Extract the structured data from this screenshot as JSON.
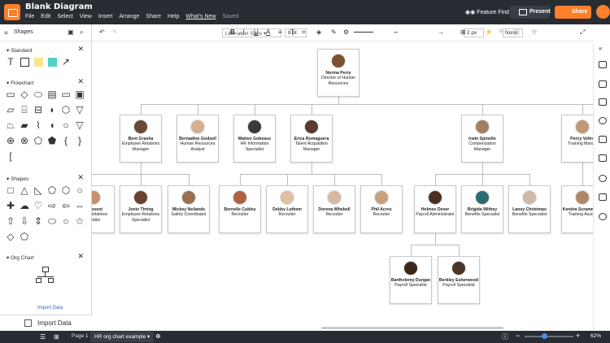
{
  "app": {
    "title": "Blank Diagram",
    "saved": "Saved"
  },
  "menu": [
    "File",
    "Edit",
    "Select",
    "View",
    "Insert",
    "Arrange",
    "Share",
    "Help",
    "What's New"
  ],
  "header": {
    "feature_find": "Feature Find",
    "present": "Present",
    "share": "Share"
  },
  "left_panel": {
    "title": "Shapes",
    "sections": {
      "standard": "Standard",
      "flowchart": "Flowchart",
      "shapes": "Shapes",
      "orgchart": "Org Chart"
    },
    "import_data_small": "Import Data",
    "import_data": "Import Data"
  },
  "toolbar": {
    "font": "Liberation Sans",
    "size": "8 pt",
    "line_width": "2 px",
    "arrow_start": "None"
  },
  "bottom": {
    "page": "Page 1",
    "tab": "HR org chart example",
    "zoom": "62%"
  },
  "org": [
    {
      "id": "root",
      "name": "Norma Perry",
      "title": "Director of Human Resources",
      "photo": "#7a5030"
    },
    {
      "id": "bent",
      "name": "Bent Grasha",
      "title": "Employee Relations Manager",
      "photo": "#6b4a35"
    },
    {
      "id": "bern",
      "name": "Bernadine Godsell",
      "title": "Human Resources Analyst",
      "photo": "#d8b090"
    },
    {
      "id": "matt",
      "name": "Matteo Gobeaux",
      "title": "HR Information Specialist",
      "photo": "#3a3a3a"
    },
    {
      "id": "eric",
      "name": "Erica Romaguera",
      "title": "Talent Acquisition Manager",
      "photo": "#5a3a28"
    },
    {
      "id": "irwin",
      "name": "Irwin Spinello",
      "title": "Compensation Manager",
      "photo": "#a08060"
    },
    {
      "id": "percy",
      "name": "Percy Veltre",
      "title": "Training Manag",
      "photo": "#c09878"
    },
    {
      "id": "rosoni",
      "name": "a Rosoni",
      "title": "oyee Relations ecialist",
      "photo": "#c89070"
    },
    {
      "id": "jonis",
      "name": "Jonis Thring",
      "title": "Employee Relations Specialist",
      "photo": "#6a4030"
    },
    {
      "id": "mickey",
      "name": "Mickey Neilands",
      "title": "Safety Coordinator",
      "photo": "#9a7050"
    },
    {
      "id": "bernelle",
      "name": "Bernelle Cubley",
      "title": "Recruiter",
      "photo": "#b06040"
    },
    {
      "id": "debby",
      "name": "Debby Lethem",
      "title": "Recruiter",
      "photo": "#e0c0a0"
    },
    {
      "id": "dorena",
      "name": "Dorena Whebell",
      "title": "Recruiter",
      "photo": "#d8b8a0"
    },
    {
      "id": "phil",
      "name": "Phil Acres",
      "title": "Recruiter",
      "photo": "#c8a080"
    },
    {
      "id": "holmes",
      "name": "Holmes Dever",
      "title": "Payroll Administrator",
      "photo": "#4a3020"
    },
    {
      "id": "brigida",
      "name": "Brigida Withey",
      "title": "Benefits Specialist",
      "photo": "#2a6a70"
    },
    {
      "id": "laney",
      "name": "Laney Christmas",
      "title": "Benefits Specialist",
      "photo": "#d0b8a8"
    },
    {
      "id": "kendra",
      "name": "Kendra Scrammage",
      "title": "Training Associ",
      "photo": "#b08868"
    },
    {
      "id": "barth",
      "name": "Bartholemy Durgan",
      "title": "Payroll Specialist",
      "photo": "#3a2818"
    },
    {
      "id": "berkley",
      "name": "Berkley Esherwood",
      "title": "Payroll Specialist",
      "photo": "#4a3426"
    }
  ]
}
